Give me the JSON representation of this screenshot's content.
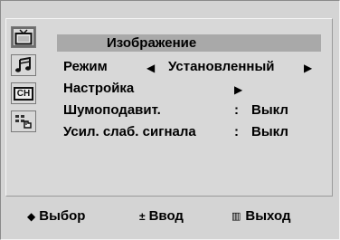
{
  "menu": {
    "title": "Изображение",
    "rows": [
      {
        "label": "Режим",
        "left_arrow": "◀",
        "value": "Установленный",
        "right_arrow": "▶"
      },
      {
        "label": "Настройка",
        "right_arrow": "▶"
      },
      {
        "label": "Шумоподавит.",
        "sep": ":",
        "value": "Выкл"
      },
      {
        "label": "Усил. слаб. сигнала",
        "sep": ":",
        "value": "Выкл"
      }
    ]
  },
  "sidebar": {
    "icons": [
      {
        "name": "tv-picture-icon",
        "active": true
      },
      {
        "name": "music-note-icon",
        "active": false
      },
      {
        "name": "channel-icon",
        "label": "CH",
        "active": false
      },
      {
        "name": "setup-icon",
        "active": false
      }
    ]
  },
  "footer": {
    "select_glyph": "◆",
    "select_label": "Выбор",
    "enter_glyph": "±",
    "enter_label": "Ввод",
    "exit_glyph": "▥",
    "exit_label": "Выход"
  },
  "colors": {
    "background": "#d4d4d4",
    "title_bar": "#a9a9a9",
    "text": "#000000"
  }
}
